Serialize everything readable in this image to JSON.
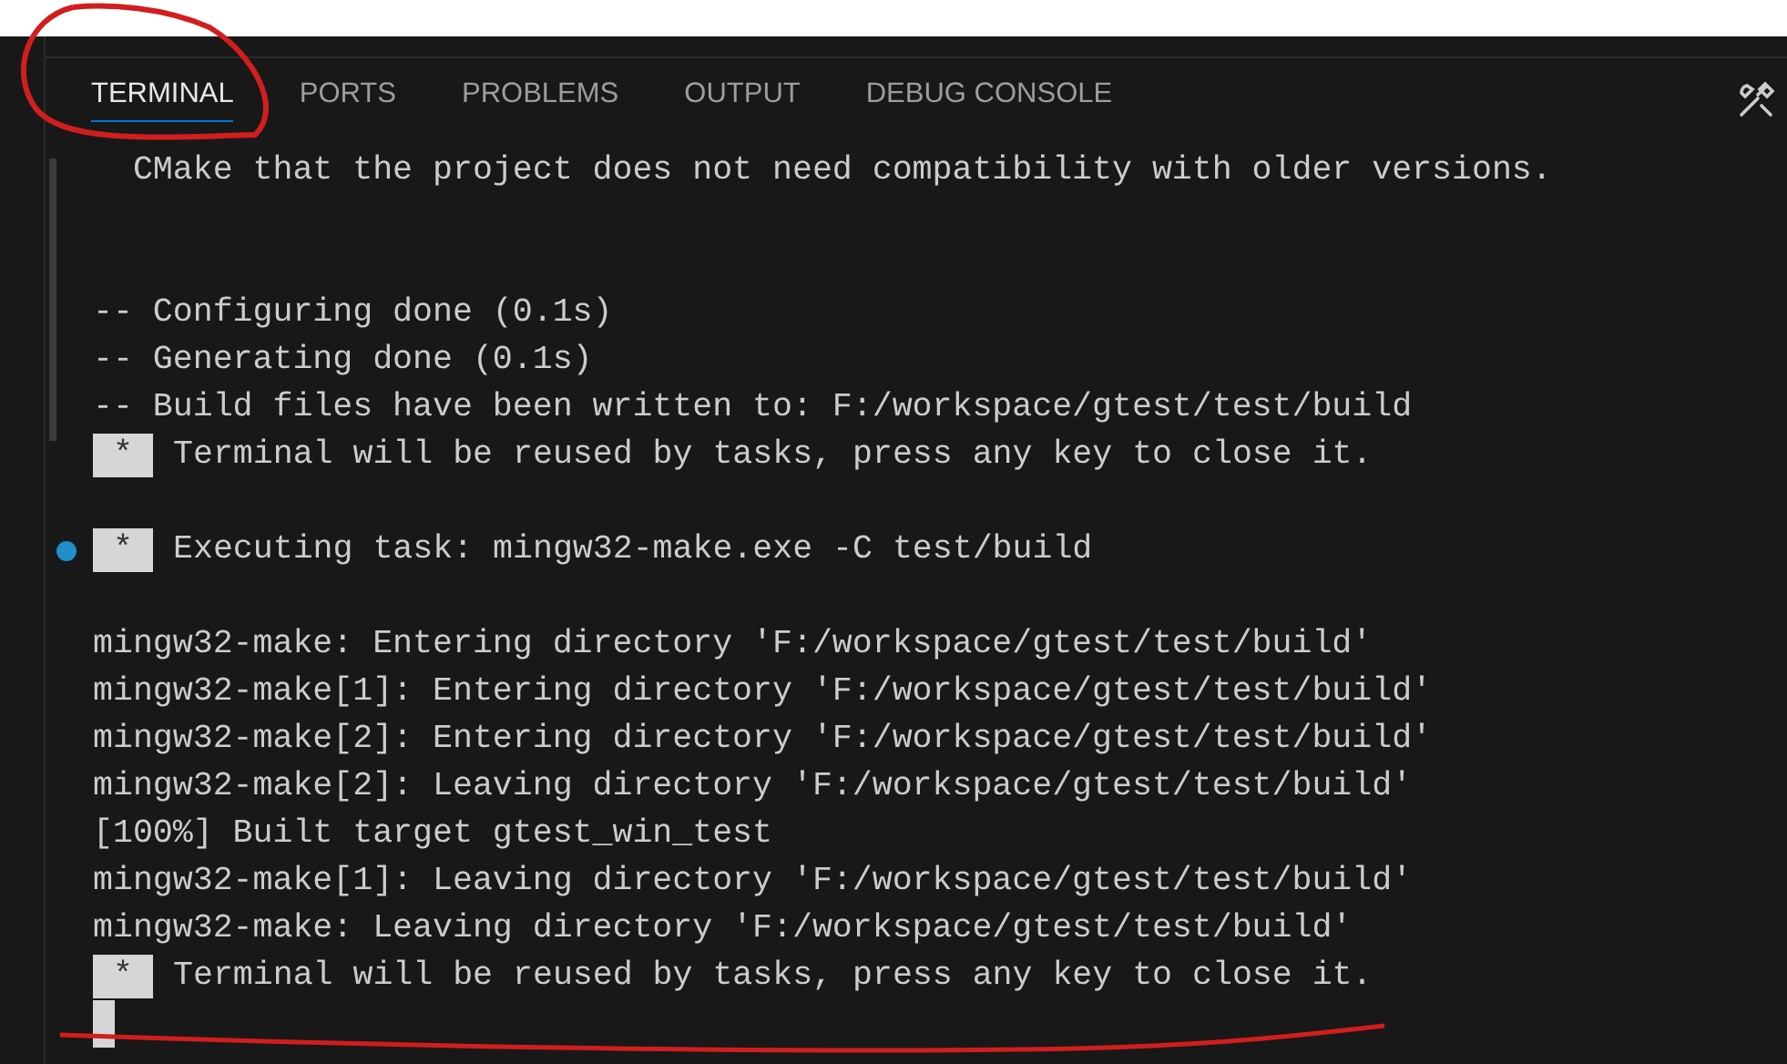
{
  "panel": {
    "tabs": [
      {
        "label": "TERMINAL",
        "selected": true
      },
      {
        "label": "PORTS",
        "selected": false
      },
      {
        "label": "PROBLEMS",
        "selected": false
      },
      {
        "label": "OUTPUT",
        "selected": false
      },
      {
        "label": "DEBUG CONSOLE",
        "selected": false
      }
    ]
  },
  "terminal": {
    "lines": [
      {
        "kind": "text",
        "text": "  CMake that the project does not need compatibility with older versions."
      },
      {
        "kind": "blank"
      },
      {
        "kind": "blank"
      },
      {
        "kind": "text",
        "text": "-- Configuring done (0.1s)"
      },
      {
        "kind": "text",
        "text": "-- Generating done (0.1s)"
      },
      {
        "kind": "text",
        "text": "-- Build files have been written to: F:/workspace/gtest/test/build"
      },
      {
        "kind": "task",
        "badge": "*",
        "text": "Terminal will be reused by tasks, press any key to close it.",
        "decorated": false
      },
      {
        "kind": "blank"
      },
      {
        "kind": "task",
        "badge": "*",
        "text": "Executing task: mingw32-make.exe -C test/build",
        "decorated": true
      },
      {
        "kind": "blank"
      },
      {
        "kind": "text",
        "text": "mingw32-make: Entering directory 'F:/workspace/gtest/test/build'"
      },
      {
        "kind": "text",
        "text": "mingw32-make[1]: Entering directory 'F:/workspace/gtest/test/build'"
      },
      {
        "kind": "text",
        "text": "mingw32-make[2]: Entering directory 'F:/workspace/gtest/test/build'"
      },
      {
        "kind": "text",
        "text": "mingw32-make[2]: Leaving directory 'F:/workspace/gtest/test/build'"
      },
      {
        "kind": "text",
        "text": "[100%] Built target gtest_win_test"
      },
      {
        "kind": "text",
        "text": "mingw32-make[1]: Leaving directory 'F:/workspace/gtest/test/build'"
      },
      {
        "kind": "text",
        "text": "mingw32-make: Leaving directory 'F:/workspace/gtest/test/build'"
      },
      {
        "kind": "task",
        "badge": "*",
        "text": "Terminal will be reused by tasks, press any key to close it.",
        "decorated": false
      },
      {
        "kind": "cursor"
      }
    ]
  }
}
